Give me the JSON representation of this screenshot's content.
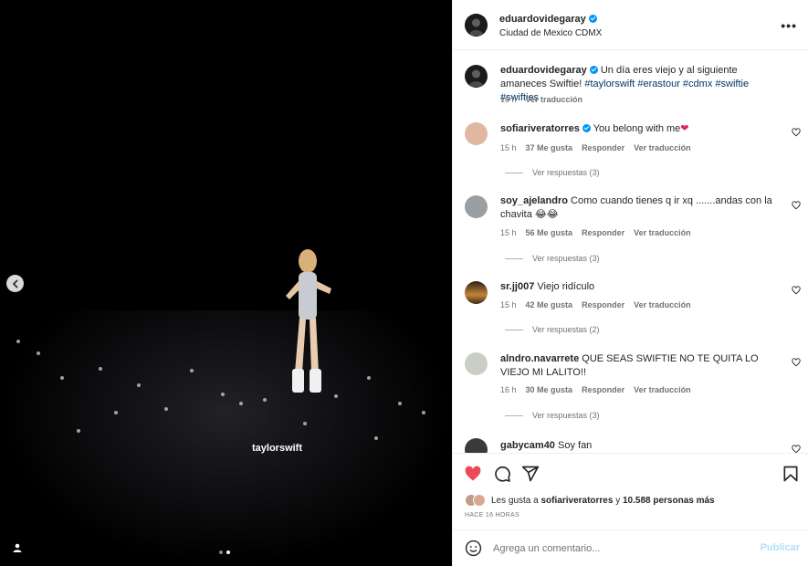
{
  "media": {
    "tag_label": "taylorswift",
    "prev_icon": "chevron-left-icon",
    "user_icon": "person-icon"
  },
  "header": {
    "username": "eduardovidegaray",
    "location": "Ciudad de Mexico CDMX",
    "more_icon": "more-icon",
    "more_label": "•••"
  },
  "caption": {
    "username": "eduardovidegaray",
    "text": "Un día eres viejo y al siguiente amaneces Swiftie!",
    "hashtags": "#taylorswift #erastour #cdmx #swiftie #swifties",
    "time": "16 h",
    "translate": "Ver traducción"
  },
  "comments": [
    {
      "username": "sofiariveratorres",
      "verified": true,
      "text": "You belong with me",
      "emoji": "❤",
      "time": "15 h",
      "likes": "37 Me gusta",
      "reply": "Responder",
      "translate": "Ver traducción",
      "replies": "Ver respuestas (3)"
    },
    {
      "username": "soy_ajelandro",
      "text": "Como cuando tienes q ir xq .......andas con la chavita",
      "emoji": "😂😂",
      "time": "15 h",
      "likes": "56 Me gusta",
      "reply": "Responder",
      "translate": "Ver traducción",
      "replies": "Ver respuestas (3)"
    },
    {
      "username": "sr.jj007",
      "text": "Viejo ridículo",
      "time": "15 h",
      "likes": "42 Me gusta",
      "reply": "Responder",
      "translate": "Ver traducción",
      "replies": "Ver respuestas (2)"
    },
    {
      "username": "alndro.navarrete",
      "text": "QUE SEAS SWIFTIE NO TE QUITA LO VIEJO MI LALITO!!",
      "time": "16 h",
      "likes": "30 Me gusta",
      "reply": "Responder",
      "translate": "Ver traducción",
      "replies": "Ver respuestas (3)"
    },
    {
      "username": "gabycam40",
      "text": "Soy fan"
    }
  ],
  "actions": {
    "like_icon": "heart-filled-icon",
    "comment_icon": "comment-icon",
    "share_icon": "share-icon",
    "save_icon": "bookmark-icon",
    "likes_prefix": "Les gusta a",
    "likes_user": "sofiariveratorres",
    "likes_and": "y",
    "likes_others": "10.588 personas más",
    "posted_ago": "HACE 16 HORAS"
  },
  "add_comment": {
    "placeholder": "Agrega un comentario...",
    "publish": "Publicar",
    "emoji_icon": "smiley-icon"
  },
  "colors": {
    "accent": "#0095f6",
    "like": "#ed4956",
    "link": "#00376b"
  }
}
